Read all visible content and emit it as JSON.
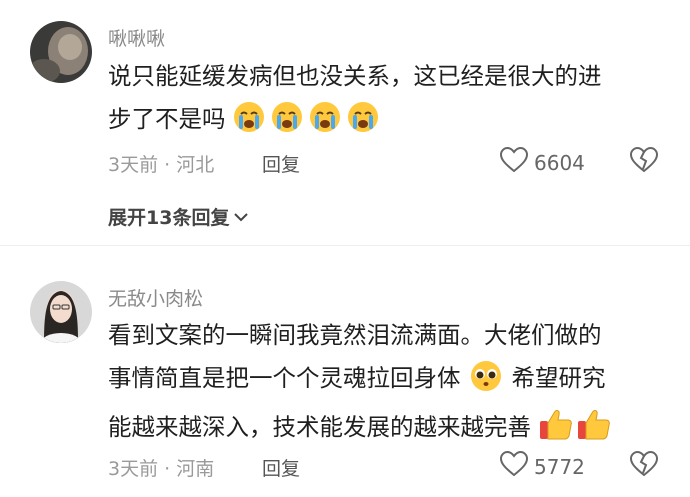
{
  "comments": [
    {
      "username": "啾啾啾",
      "text_line1": "说只能延缓发病但也没关系，这已经是很大的进",
      "text_line2": "步了不是吗",
      "emoji": "crying-face-icon x4",
      "meta": "3天前 · 河北",
      "reply_label": "回复",
      "likes": "6604",
      "expand_label": "展开13条回复"
    },
    {
      "username": "无敌小肉松",
      "text_line1": "看到文案的一瞬间我竟然泪流满面。大佬们做的",
      "text_line2": "事情简直是把一个个灵魂拉回身体",
      "text_line2b": "希望研究",
      "text_line3": "能越来越深入，技术能发展的越来越完善",
      "meta": "3天前 · 河南",
      "reply_label": "回复",
      "likes": "5772"
    }
  ],
  "colors": {
    "username": "#8a8a8a",
    "meta": "#9a9a9a",
    "text": "#1f1f1f"
  }
}
